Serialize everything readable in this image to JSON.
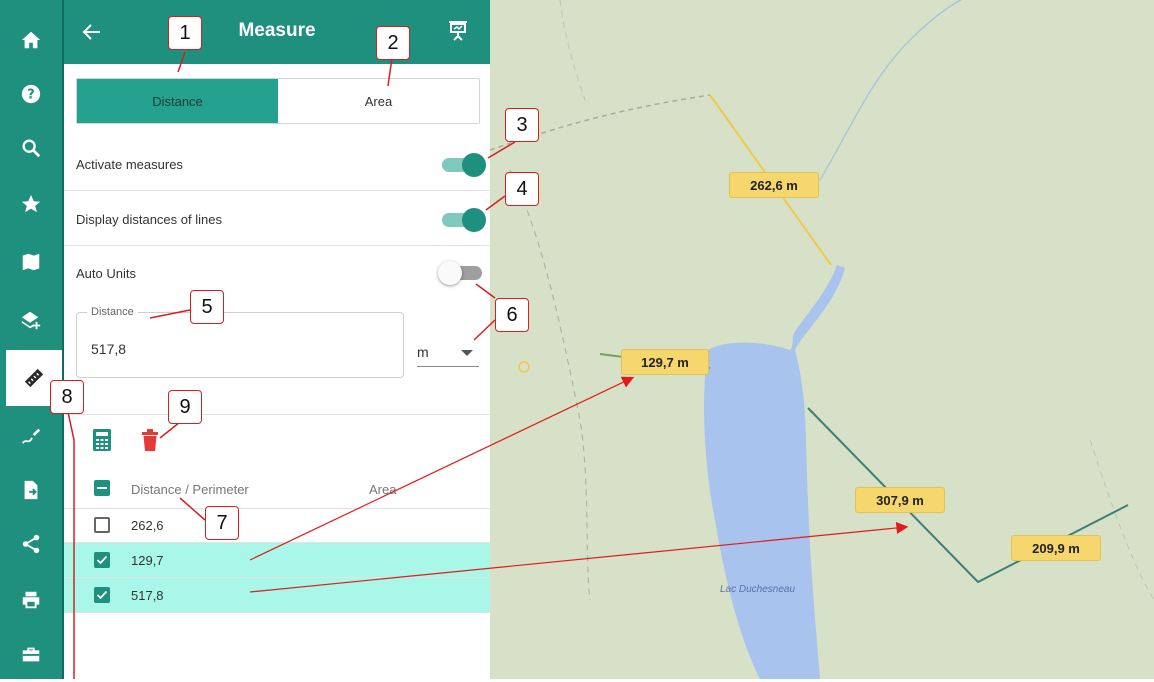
{
  "rail": {
    "items": [
      {
        "icon": "home-icon"
      },
      {
        "icon": "help-icon"
      },
      {
        "icon": "search-icon"
      },
      {
        "icon": "star-icon"
      },
      {
        "icon": "map-icon"
      },
      {
        "icon": "layers-add-icon"
      },
      {
        "icon": "ruler-icon",
        "active": true
      },
      {
        "icon": "draw-icon"
      },
      {
        "icon": "import-file-icon"
      },
      {
        "icon": "share-icon"
      },
      {
        "icon": "print-icon"
      },
      {
        "icon": "toolbox-icon"
      }
    ]
  },
  "header": {
    "title": "Measure",
    "back_icon": "arrow-left-icon",
    "present_icon": "presentation-icon"
  },
  "tabs": {
    "distance": "Distance",
    "area": "Area"
  },
  "settings": {
    "activate_measures": {
      "label": "Activate measures",
      "on": true
    },
    "display_distances": {
      "label": "Display distances of lines",
      "on": true
    },
    "auto_units": {
      "label": "Auto Units",
      "on": false
    }
  },
  "distance_field": {
    "legend": "Distance",
    "value": "517,8"
  },
  "unit_select": {
    "value": "m"
  },
  "toolbar": {
    "calculator_icon": "calculator-icon",
    "delete_icon": "trash-icon"
  },
  "table": {
    "headers": {
      "distance": "Distance / Perimeter",
      "area": "Area"
    },
    "rows": [
      {
        "value": "262,6",
        "checked": false
      },
      {
        "value": "129,7",
        "checked": true
      },
      {
        "value": "517,8",
        "checked": true
      }
    ]
  },
  "map": {
    "labels": [
      "262,6 m",
      "129,7 m",
      "307,9 m",
      "209,9 m"
    ],
    "lake_name": "Lac Duchesneau"
  },
  "callouts": [
    "1",
    "2",
    "3",
    "4",
    "5",
    "6",
    "7",
    "8",
    "9"
  ],
  "colors": {
    "primary": "#1f8f7e",
    "selected_row": "#a8f7e9",
    "label_bg": "#f5d76e",
    "callout_border": "#d62020",
    "delete": "#e53935"
  }
}
